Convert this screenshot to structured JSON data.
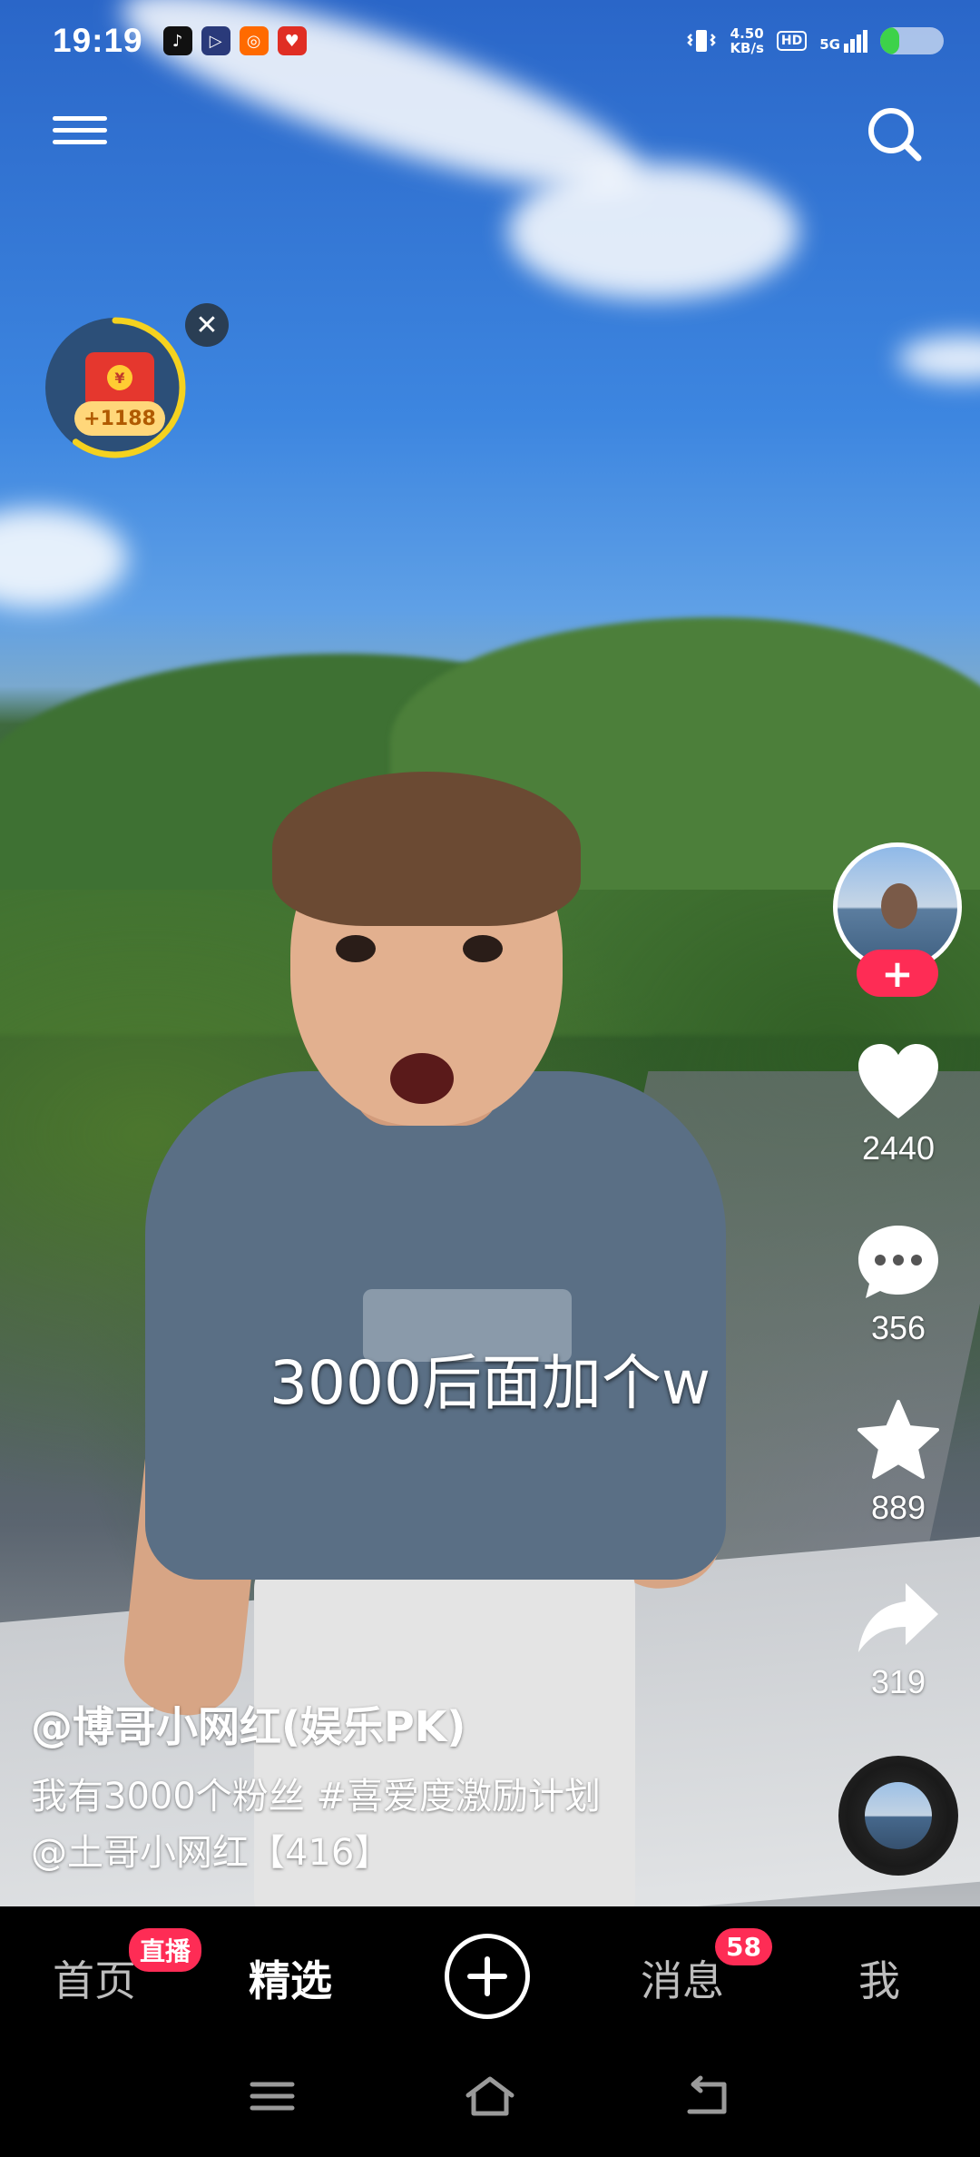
{
  "status_bar": {
    "time": "19:19",
    "net_speed_value": "4.50",
    "net_speed_unit": "KB/s",
    "hd_label": "HD",
    "network_label": "5G",
    "battery_percent": 0.3,
    "app_icons": [
      "tiktok-icon",
      "video-icon",
      "kuaishou-icon",
      "pinduoduo-icon"
    ]
  },
  "reward": {
    "amount": "+1188",
    "coin_symbol": "¥",
    "close_glyph": "✕",
    "progress": 0.6
  },
  "video": {
    "subtitle": "3000后面加个w",
    "author": "@博哥小网红(娱乐PK)",
    "description_line1": "我有3000个粉丝 #喜爱度激励计划",
    "description_line2": "@土哥小网红【416】"
  },
  "actions": {
    "follow_glyph": "+",
    "likes": "2440",
    "comments": "356",
    "favorites": "889",
    "shares": "319"
  },
  "tabs": {
    "home": "首页",
    "home_badge": "直播",
    "featured": "精选",
    "create_glyph": "+",
    "messages": "消息",
    "messages_badge": "58",
    "me": "我"
  },
  "colors": {
    "accent": "#fe2c55",
    "battery": "#3dd24a",
    "reward_ring": "#f5d21f"
  }
}
